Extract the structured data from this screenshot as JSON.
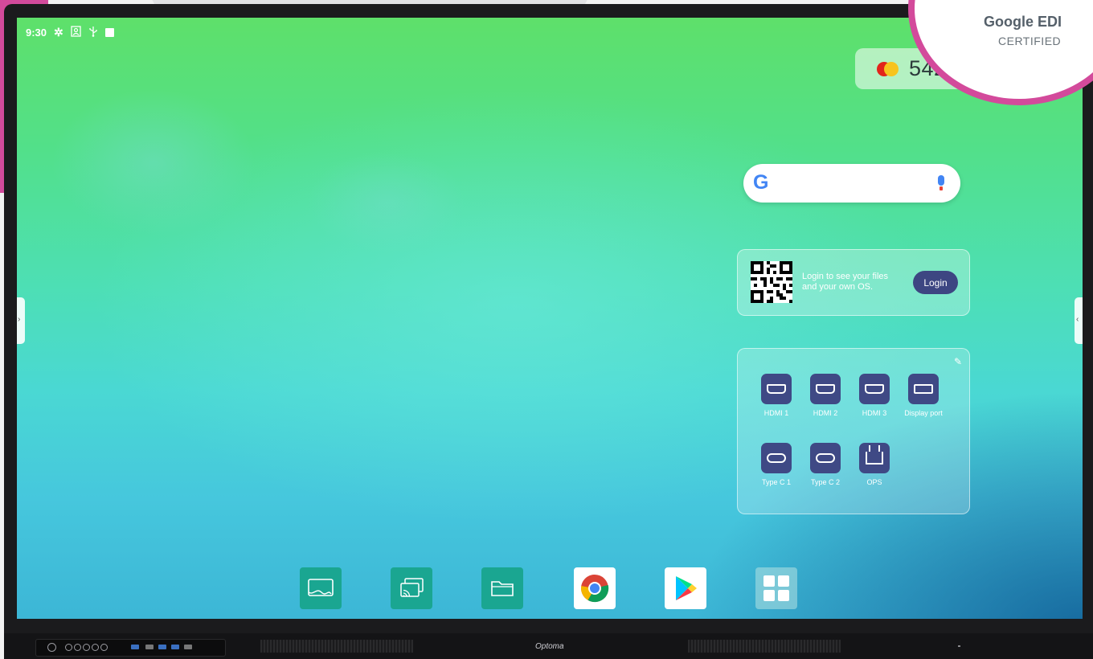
{
  "status_bar": {
    "time": "9:30",
    "icons": [
      "gear-icon",
      "portrait-icon",
      "usb-icon",
      "square-icon"
    ]
  },
  "coins_widget": {
    "value": "5421",
    "icon": "coin-icon",
    "colors": {
      "left": "#e2241b",
      "right": "#f7c41d"
    }
  },
  "google_search": {
    "logo": "G",
    "mic_icon": "mic-icon"
  },
  "login_card": {
    "text": "Login to see your files and your own OS.",
    "button_label": "Login",
    "qr_icon": "qr-code-icon"
  },
  "input_sources": {
    "edit_icon": "pencil-icon",
    "items": [
      {
        "label": "HDMI 1",
        "icon": "hdmi-port-icon"
      },
      {
        "label": "HDMI 2",
        "icon": "hdmi-port-icon"
      },
      {
        "label": "HDMI 3",
        "icon": "hdmi-port-icon"
      },
      {
        "label": "Display port",
        "icon": "displayport-icon"
      },
      {
        "label": "Type C 1",
        "icon": "usb-c-icon"
      },
      {
        "label": "Type C 2",
        "icon": "usb-c-icon"
      },
      {
        "label": "OPS",
        "icon": "ops-icon"
      }
    ]
  },
  "dock": {
    "items": [
      {
        "name": "whiteboard-app",
        "icon": "whiteboard-icon"
      },
      {
        "name": "screen-share-app",
        "icon": "cast-icon"
      },
      {
        "name": "file-manager-app",
        "icon": "folder-icon"
      },
      {
        "name": "chrome-app",
        "icon": "chrome-icon"
      },
      {
        "name": "play-store-app",
        "icon": "play-store-icon"
      },
      {
        "name": "all-apps",
        "icon": "apps-grid-icon"
      }
    ]
  },
  "badge": {
    "line1": "Google EDI",
    "line2": "CERTIFIED"
  },
  "device": {
    "brand": "Optoma"
  },
  "colors": {
    "accent_pink": "#d34a9b",
    "button_indigo": "#3d4682",
    "dock_teal": "#1aa691"
  }
}
